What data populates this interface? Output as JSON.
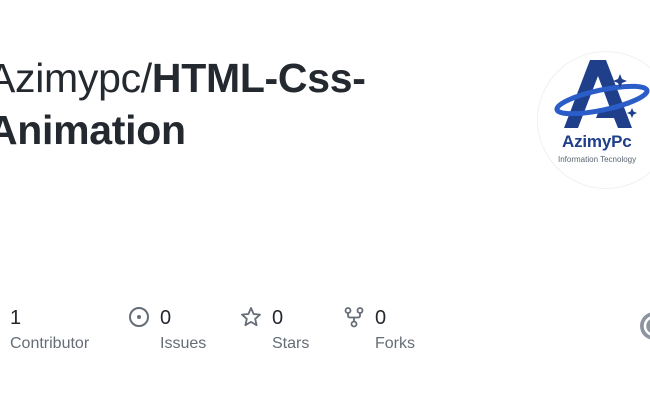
{
  "repo": {
    "owner": "Azimypc/",
    "name_line1": "HTML-Css-",
    "name_line2": "Animation"
  },
  "logo": {
    "name": "AzimyPc",
    "tagline": "Information Tecnology",
    "colors": {
      "primary": "#1f3f8a",
      "ring": "#2b5dc9"
    }
  },
  "stats": [
    {
      "icon": "people-icon",
      "value": "1",
      "label": "Contributor"
    },
    {
      "icon": "issue-opened-icon",
      "value": "0",
      "label": "Issues"
    },
    {
      "icon": "star-icon",
      "value": "0",
      "label": "Stars"
    },
    {
      "icon": "repo-forked-icon",
      "value": "0",
      "label": "Forks"
    }
  ],
  "colors": {
    "text": "#24292f",
    "muted": "#656d76",
    "icon": "#656d76"
  }
}
